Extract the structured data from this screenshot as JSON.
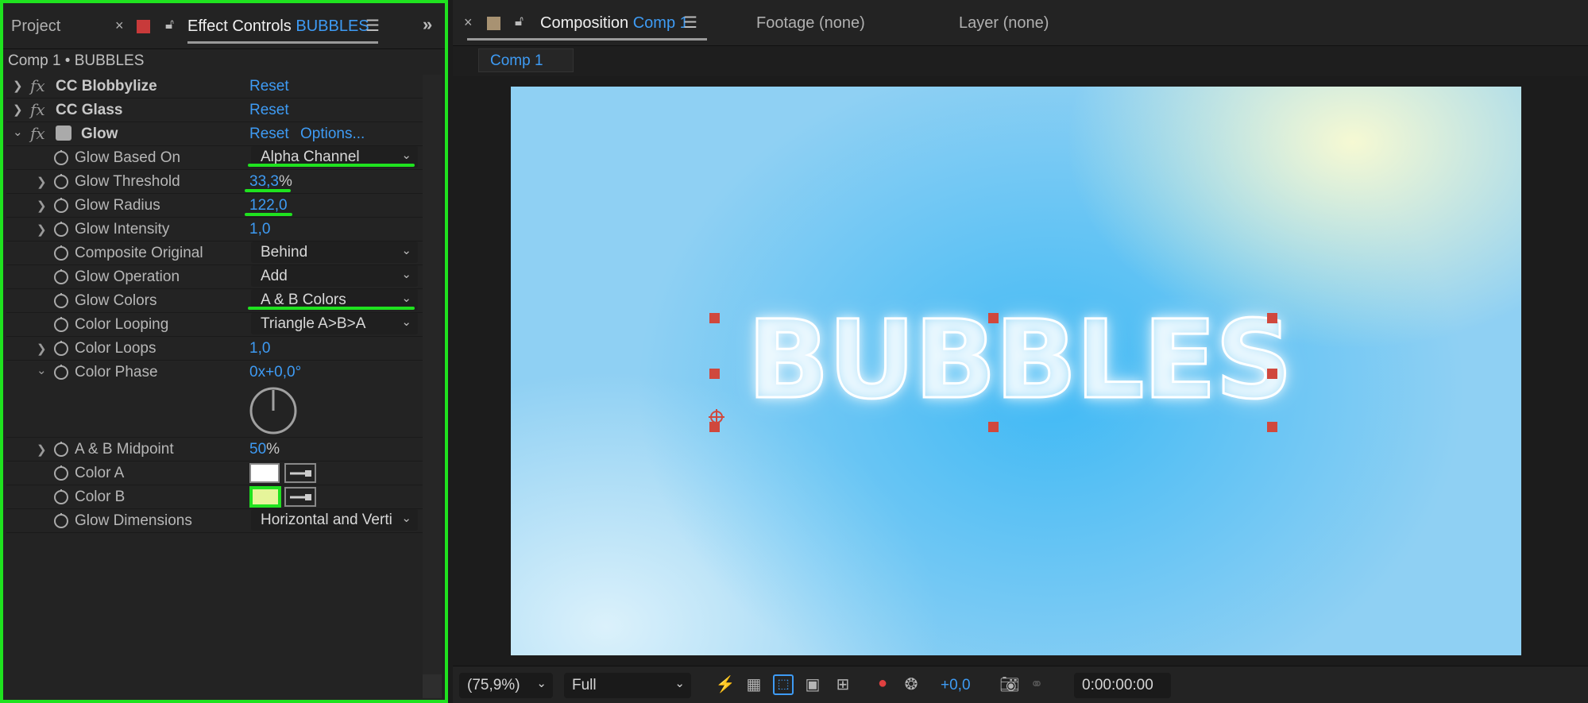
{
  "left_panel": {
    "tabs": {
      "project": "Project",
      "effect_controls_prefix": "Effect Controls",
      "effect_controls_layer": "BUBBLES"
    },
    "breadcrumb": "Comp 1 • BUBBLES",
    "effects": [
      {
        "name": "CC Blobbylize",
        "reset": "Reset"
      },
      {
        "name": "CC Glass",
        "reset": "Reset"
      },
      {
        "name": "Glow",
        "reset": "Reset",
        "options": "Options..."
      }
    ],
    "glow_params": {
      "glow_based_on": {
        "label": "Glow Based On",
        "value": "Alpha Channel"
      },
      "glow_threshold": {
        "label": "Glow Threshold",
        "value": "33,3",
        "unit": "%"
      },
      "glow_radius": {
        "label": "Glow Radius",
        "value": "122,0"
      },
      "glow_intensity": {
        "label": "Glow Intensity",
        "value": "1,0"
      },
      "composite_original": {
        "label": "Composite Original",
        "value": "Behind"
      },
      "glow_operation": {
        "label": "Glow Operation",
        "value": "Add"
      },
      "glow_colors": {
        "label": "Glow Colors",
        "value": "A & B Colors"
      },
      "color_looping": {
        "label": "Color Looping",
        "value": "Triangle A>B>A"
      },
      "color_loops": {
        "label": "Color Loops",
        "value": "1,0"
      },
      "color_phase": {
        "label": "Color Phase",
        "value_rev": "0x",
        "value_deg": "+0,0°"
      },
      "ab_midpoint": {
        "label": "A & B Midpoint",
        "value": "50",
        "unit": "%"
      },
      "color_a": {
        "label": "Color A",
        "swatch": "#ffffff"
      },
      "color_b": {
        "label": "Color B",
        "swatch": "#e6f59a"
      },
      "glow_dimensions": {
        "label": "Glow Dimensions",
        "value": "Horizontal and Verti"
      }
    }
  },
  "right_panel": {
    "tabs": {
      "composition_prefix": "Composition",
      "composition_name": "Comp 1",
      "footage": "Footage (none)",
      "layer": "Layer (none)"
    },
    "comp_chip": "Comp 1",
    "canvas_text": "BUBBLES",
    "toolbar": {
      "zoom": "(75,9%)",
      "resolution": "Full",
      "exposure": "+0,0",
      "timecode": "0:00:00:00"
    }
  },
  "colors": {
    "accent_blue": "#3e9bf4",
    "highlight_green": "#1fe21f",
    "handle_red": "#d0483d"
  }
}
